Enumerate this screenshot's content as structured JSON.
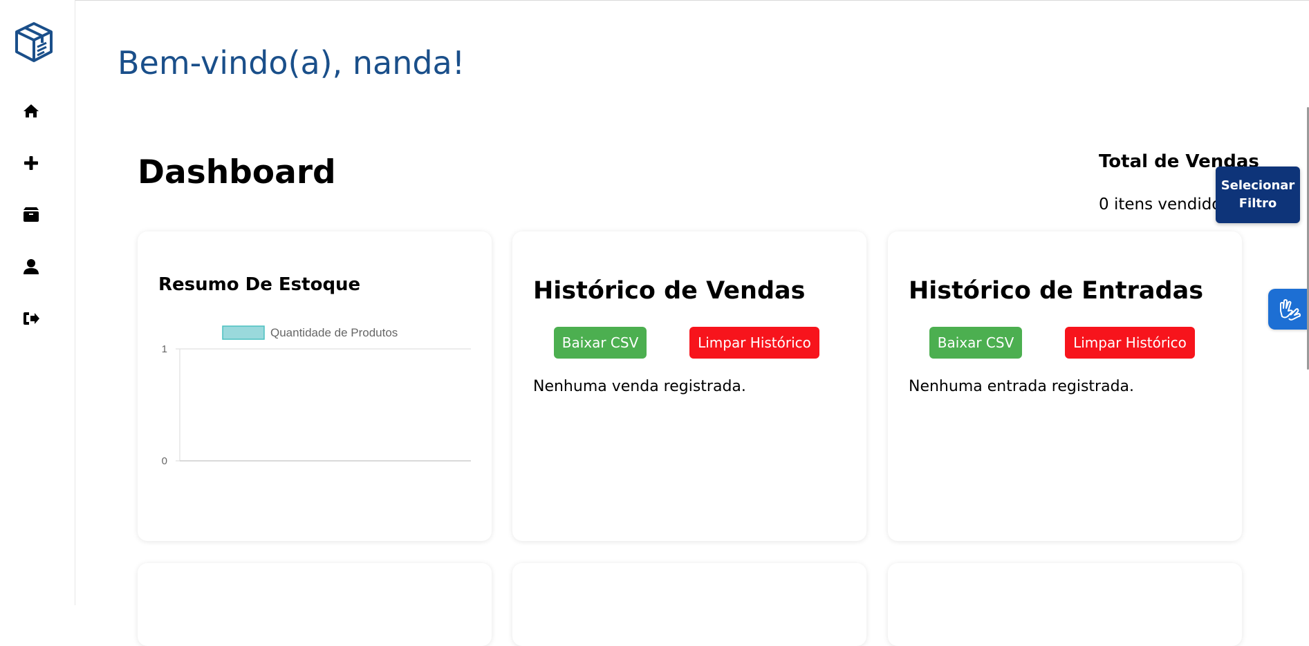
{
  "header": {
    "welcome": "Bem-vindo(a), nanda!"
  },
  "sidebar": {
    "logo_icon": "box-logo-icon",
    "items": [
      {
        "name": "home",
        "icon": "home-icon"
      },
      {
        "name": "add",
        "icon": "plus-icon"
      },
      {
        "name": "products",
        "icon": "box-icon"
      },
      {
        "name": "profile",
        "icon": "user-icon"
      },
      {
        "name": "logout",
        "icon": "sign-out-icon"
      }
    ]
  },
  "dashboard": {
    "title": "Dashboard",
    "total_sales_title": "Total de Vendas",
    "total_sales_value": "0 itens vendidos",
    "filter_button": "Selecionar Filtro"
  },
  "stock_card": {
    "title": "Resumo De Estoque"
  },
  "sales_card": {
    "title": "Histórico de Vendas",
    "download_label": "Baixar CSV",
    "clear_label": "Limpar Histórico",
    "empty_text": "Nenhuma venda registrada."
  },
  "entries_card": {
    "title": "Histórico de Entradas",
    "download_label": "Baixar CSV",
    "clear_label": "Limpar Histórico",
    "empty_text": "Nenhuma entrada registrada."
  },
  "accessibility": {
    "icon": "sign-language-hands-icon"
  },
  "colors": {
    "welcome": "#1a4f8a",
    "filter_button": "#0e3479",
    "green": "#4caf50",
    "red": "#f7141c",
    "accessibility": "#1d6fd4",
    "legend_fill": "#9ad9dc",
    "legend_stroke": "#4bc0c0"
  },
  "chart_data": {
    "type": "bar",
    "title": "",
    "categories": [],
    "series": [
      {
        "name": "Quantidade de Produtos",
        "values": []
      }
    ],
    "ylim": [
      0,
      1
    ],
    "yticks": [
      "0",
      "1"
    ],
    "legend": "top",
    "grid": true
  }
}
